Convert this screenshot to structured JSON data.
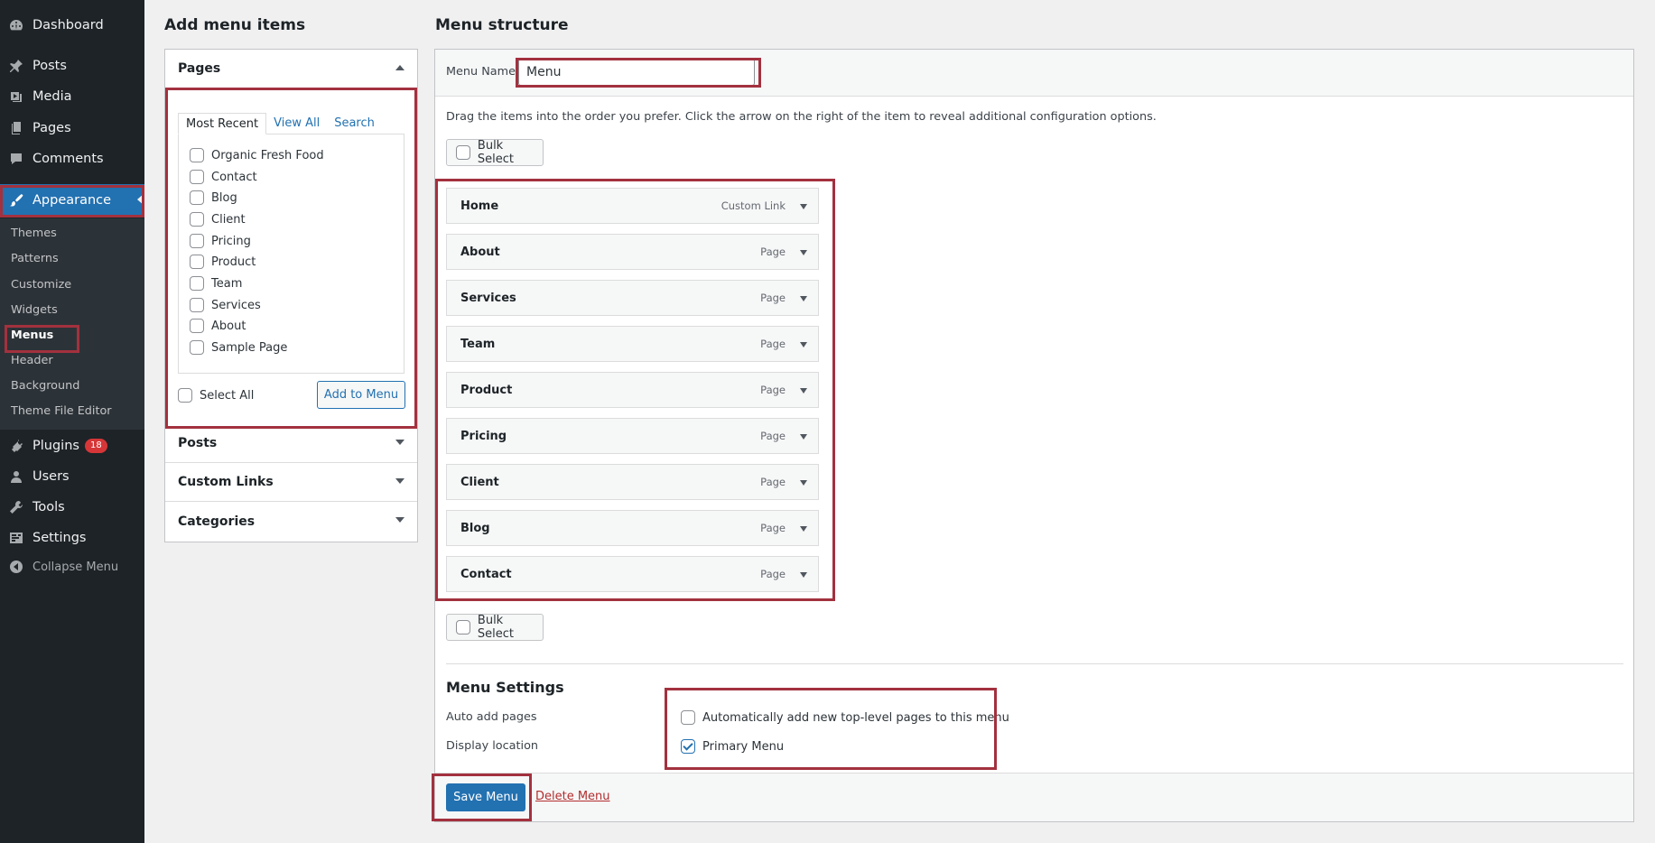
{
  "sidebar": {
    "dashboard": "Dashboard",
    "posts": "Posts",
    "media": "Media",
    "pages": "Pages",
    "comments": "Comments",
    "appearance": "Appearance",
    "submenu": [
      "Themes",
      "Patterns",
      "Customize",
      "Widgets",
      "Menus",
      "Header",
      "Background",
      "Theme File Editor"
    ],
    "plugins": "Plugins",
    "plugins_badge": "18",
    "users": "Users",
    "tools": "Tools",
    "settings": "Settings",
    "collapse": "Collapse Menu"
  },
  "add_items": {
    "heading": "Add menu items",
    "pages_title": "Pages",
    "tabs": [
      "Most Recent",
      "View All",
      "Search"
    ],
    "pages": [
      "Organic Fresh Food",
      "Contact",
      "Blog",
      "Client",
      "Pricing",
      "Product",
      "Team",
      "Services",
      "About",
      "Sample Page"
    ],
    "select_all": "Select All",
    "add_to_menu": "Add to Menu",
    "posts_title": "Posts",
    "custom_links_title": "Custom Links",
    "categories_title": "Categories"
  },
  "structure": {
    "heading": "Menu structure",
    "menu_name_label": "Menu Name",
    "menu_name_value": "Menu",
    "instructions": "Drag the items into the order you prefer. Click the arrow on the right of the item to reveal additional configuration options.",
    "bulk_select": "Bulk Select",
    "items": [
      {
        "title": "Home",
        "type": "Custom Link"
      },
      {
        "title": "About",
        "type": "Page"
      },
      {
        "title": "Services",
        "type": "Page"
      },
      {
        "title": "Team",
        "type": "Page"
      },
      {
        "title": "Product",
        "type": "Page"
      },
      {
        "title": "Pricing",
        "type": "Page"
      },
      {
        "title": "Client",
        "type": "Page"
      },
      {
        "title": "Blog",
        "type": "Page"
      },
      {
        "title": "Contact",
        "type": "Page"
      }
    ]
  },
  "settings": {
    "heading": "Menu Settings",
    "auto_add_label": "Auto add pages",
    "auto_add_option": "Automatically add new top-level pages to this menu",
    "display_location_label": "Display location",
    "primary_menu": "Primary Menu",
    "primary_menu_checked": true
  },
  "actions": {
    "save": "Save Menu",
    "delete": "Delete Menu"
  },
  "colors": {
    "admin_bar": "#1d2327",
    "accent": "#2271b1",
    "highlight": "#a3313e",
    "badge": "#d63638"
  }
}
